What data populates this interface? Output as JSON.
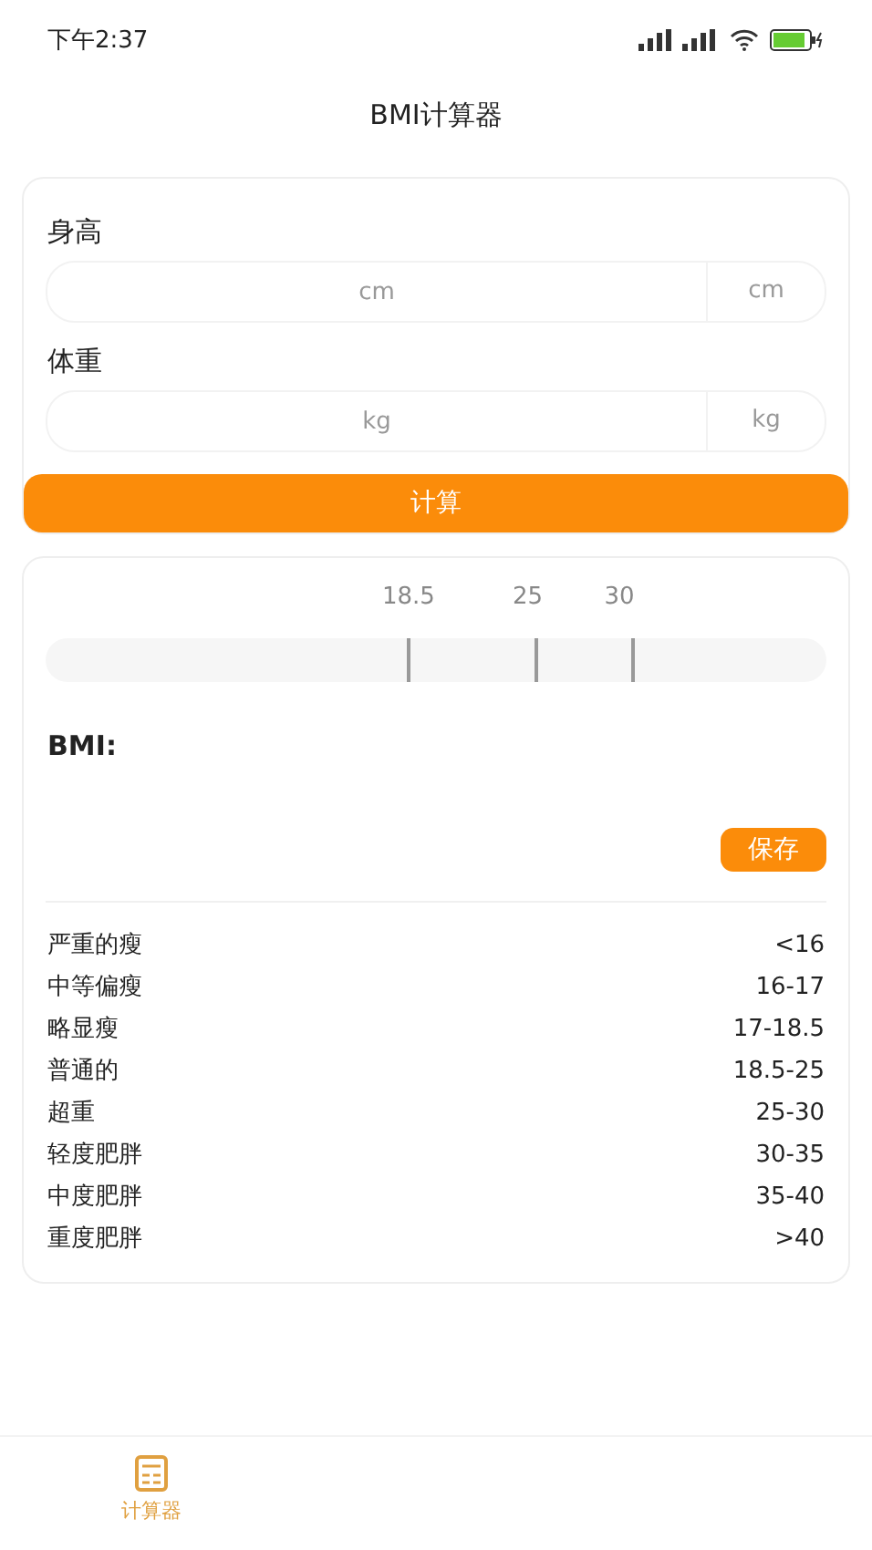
{
  "status_bar": {
    "time": "下午2:37"
  },
  "title": "BMI计算器",
  "form": {
    "fields": [
      {
        "label": "身高",
        "placeholder": "cm",
        "unit": "cm"
      },
      {
        "label": "体重",
        "placeholder": "kg",
        "unit": "kg"
      }
    ],
    "button": "计算"
  },
  "scale": {
    "marks": [
      "18.5",
      "25",
      "30"
    ]
  },
  "result": {
    "label": "BMI:",
    "save_button": "保存"
  },
  "categories": [
    {
      "name": "严重的瘦",
      "range": "<16"
    },
    {
      "name": "中等偏瘦",
      "range": "16-17"
    },
    {
      "name": "略显瘦",
      "range": "17-18.5"
    },
    {
      "name": "普通的",
      "range": "18.5-25"
    },
    {
      "name": "超重",
      "range": "25-30"
    },
    {
      "name": "轻度肥胖",
      "range": "30-35"
    },
    {
      "name": "中度肥胖",
      "range": "35-40"
    },
    {
      "name": "重度肥胖",
      "range": ">40"
    }
  ],
  "tabs": [
    {
      "label": "计算器",
      "selected": true
    }
  ]
}
